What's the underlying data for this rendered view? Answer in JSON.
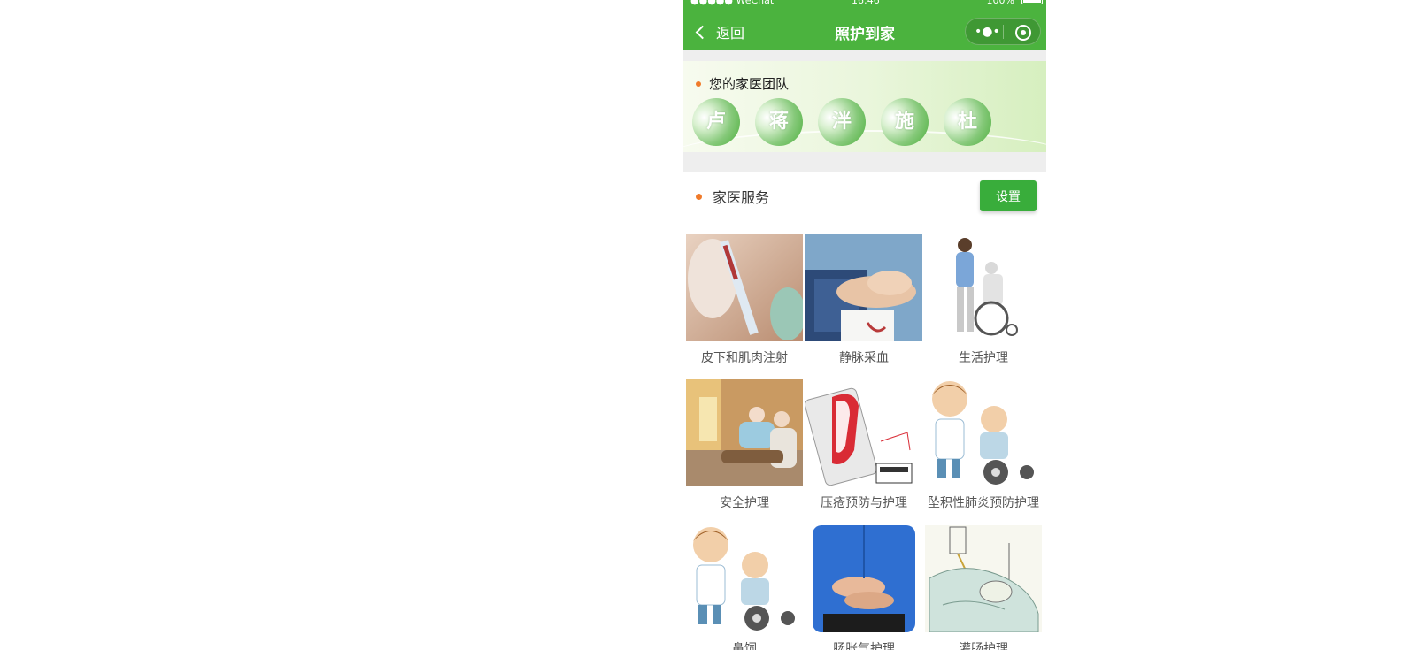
{
  "status_bar": {
    "carrier": "●●●●● WeChat",
    "time": "16:46",
    "battery": "100%"
  },
  "nav": {
    "back_label": "返回",
    "title": "照护到家",
    "more_glyph": "•●•"
  },
  "team": {
    "title": "您的家医团队",
    "doctors": [
      "卢",
      "蒋",
      "泮",
      "施",
      "杜"
    ]
  },
  "services": {
    "title": "家医服务",
    "settings_label": "设置",
    "items": [
      {
        "label": "皮下和肌肉注射",
        "icon": "injection-photo"
      },
      {
        "label": "静脉采血",
        "icon": "blood-draw-photo"
      },
      {
        "label": "生活护理",
        "icon": "wheelchair-care-photo"
      },
      {
        "label": "安全护理",
        "icon": "safety-care-photo"
      },
      {
        "label": "压疮预防与护理",
        "icon": "pressure-ulcer-illustration"
      },
      {
        "label": "坠积性肺炎预防护理",
        "icon": "pneumonia-care-illustration"
      },
      {
        "label": "鼻饲",
        "icon": "nasal-feeding-illustration"
      },
      {
        "label": "肠胀气护理",
        "icon": "flatulence-care-photo"
      },
      {
        "label": "灌肠护理",
        "icon": "enema-care-illustration"
      }
    ]
  },
  "colors": {
    "nav_green": "#4bb33e",
    "button_green": "#39ad3b",
    "bullet_orange": "#f07a2a"
  }
}
